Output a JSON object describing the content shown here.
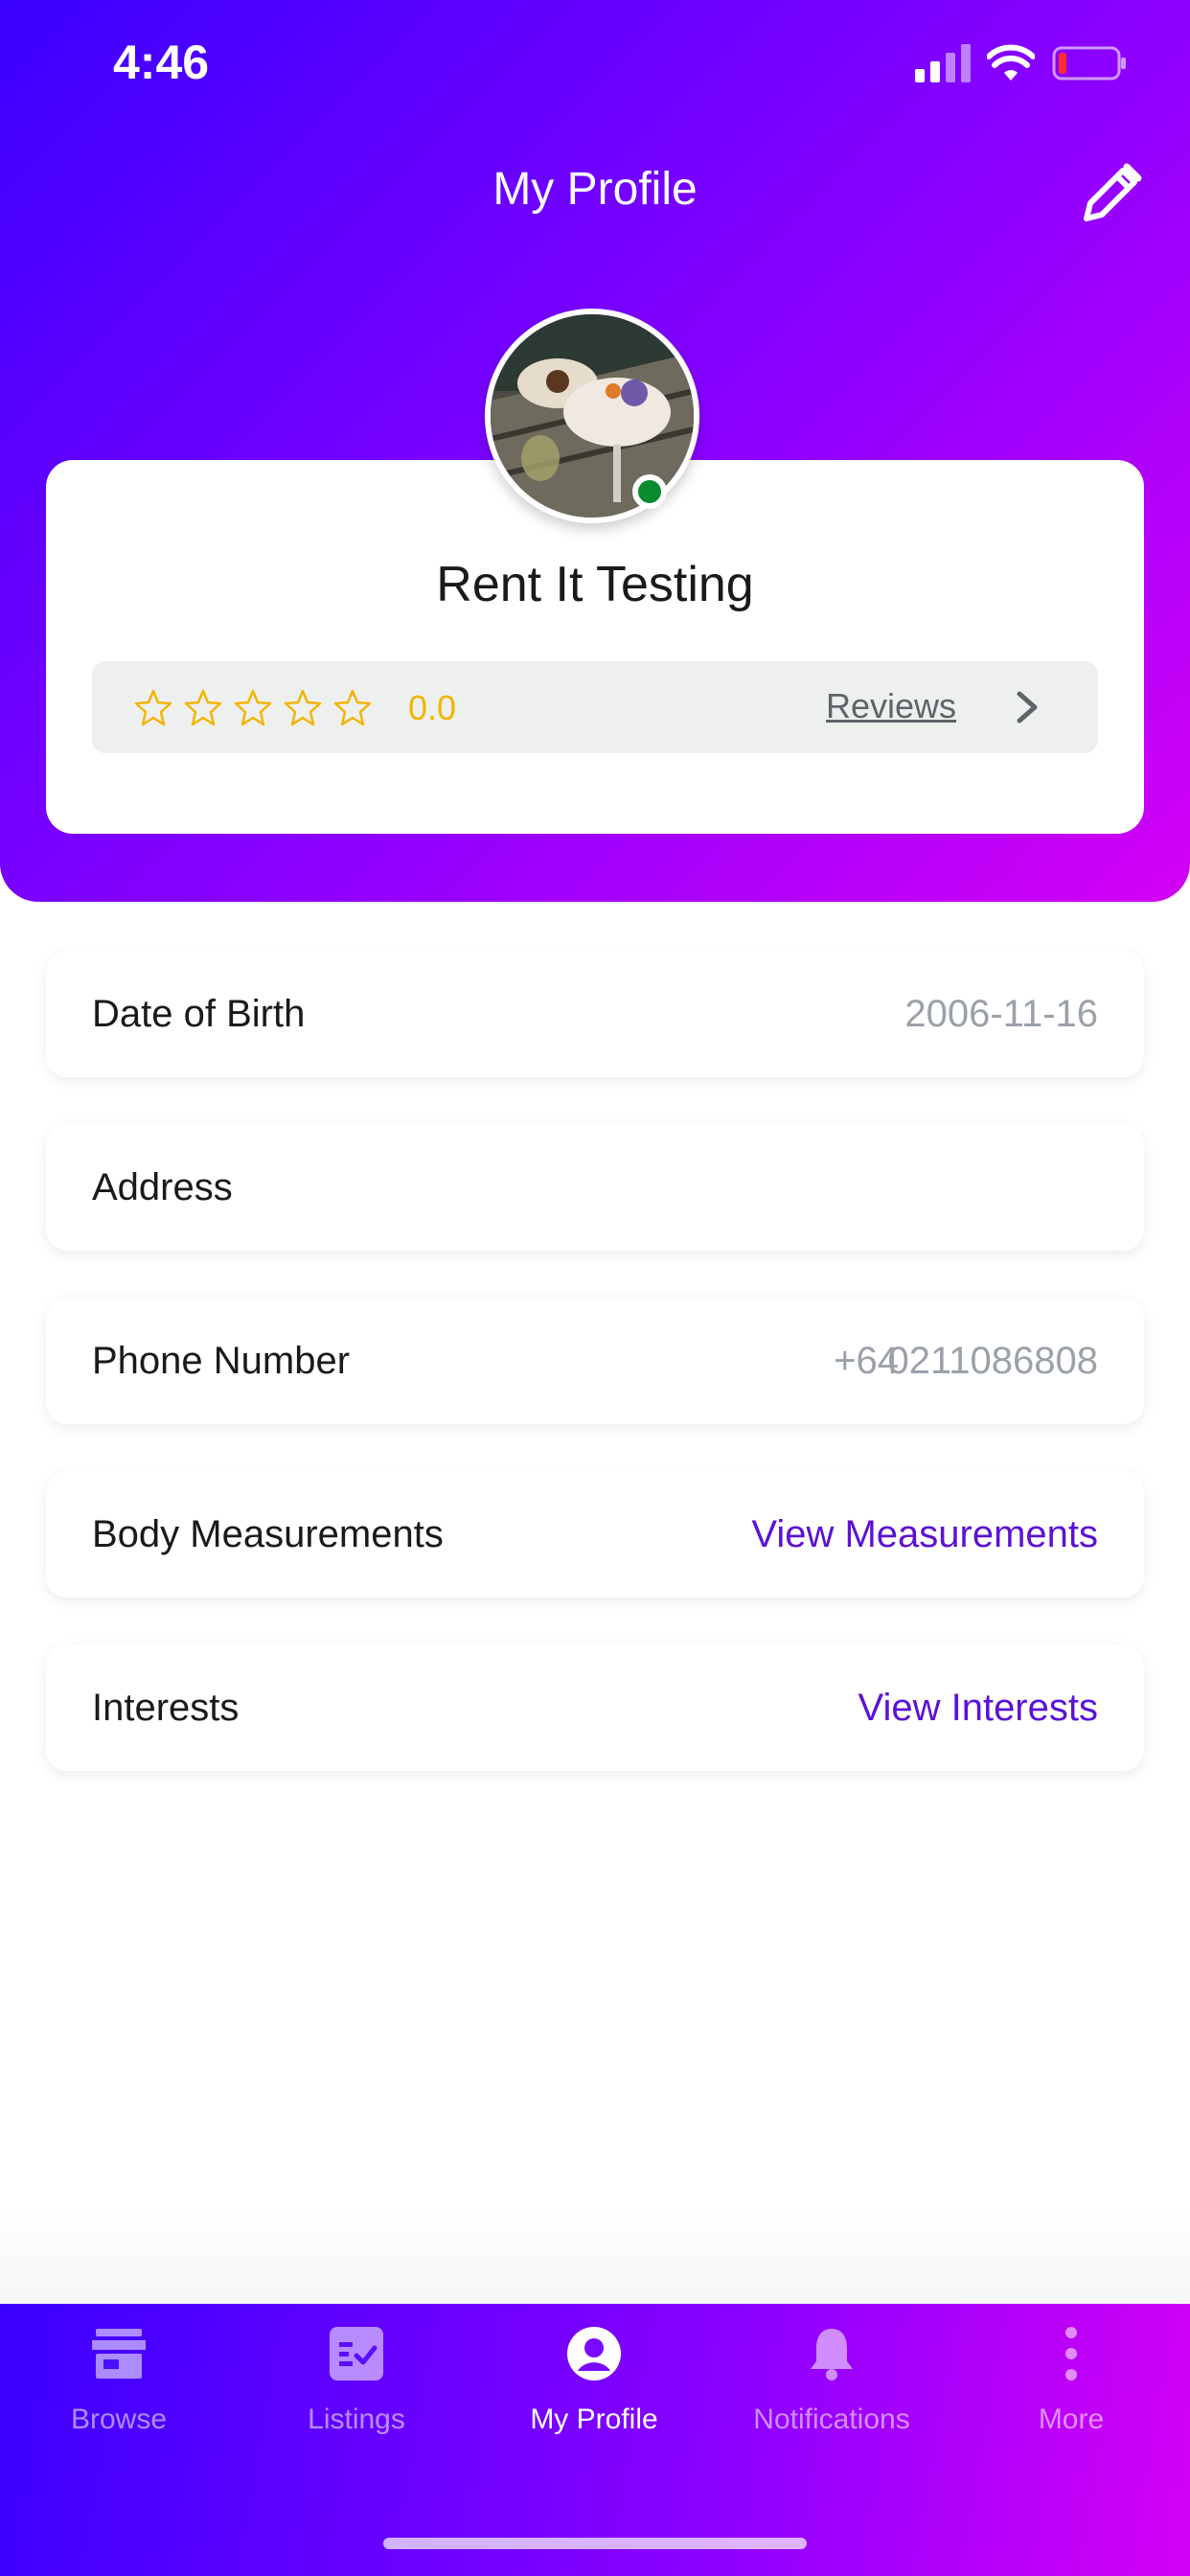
{
  "status_bar": {
    "time": "4:46"
  },
  "header": {
    "title": "My Profile"
  },
  "profile": {
    "name": "Rent It Testing",
    "rating": "0.0",
    "stars_filled": 0,
    "stars_total": 5,
    "reviews_label": "Reviews"
  },
  "details": {
    "dob": {
      "label": "Date of Birth",
      "value": "2006-11-16"
    },
    "address": {
      "label": "Address",
      "value": ""
    },
    "phone": {
      "label": "Phone Number",
      "code": "+64",
      "number": "0211086808"
    },
    "body": {
      "label": "Body Measurements",
      "link": "View Measurements"
    },
    "interests": {
      "label": "Interests",
      "link": "View Interests"
    }
  },
  "tabs": [
    {
      "label": "Browse",
      "icon": "store-icon"
    },
    {
      "label": "Listings",
      "icon": "listings-icon"
    },
    {
      "label": "My Profile",
      "icon": "profile-icon",
      "active": true
    },
    {
      "label": "Notifications",
      "icon": "bell-icon"
    },
    {
      "label": "More",
      "icon": "more-icon"
    }
  ],
  "colors": {
    "gradient_start": "#3a00ff",
    "gradient_end": "#d400f5",
    "link": "#5b12d6",
    "star": "#f4b400",
    "online": "#0a8a2e"
  }
}
